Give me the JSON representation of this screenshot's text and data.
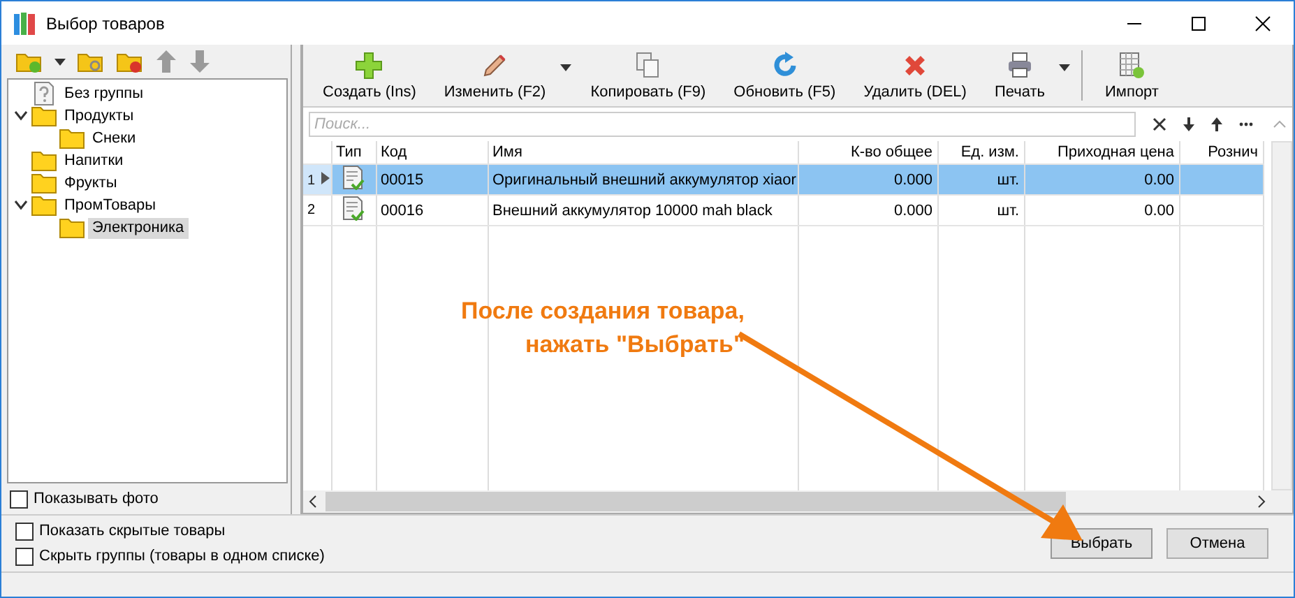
{
  "window": {
    "title": "Выбор товаров"
  },
  "tree": [
    {
      "label": "Без группы",
      "kind": "nogroup",
      "selected": false,
      "expanded": false
    },
    {
      "label": "Продукты",
      "kind": "folder",
      "selected": false,
      "expanded": true,
      "children": [
        {
          "label": "Снеки",
          "kind": "folder",
          "selected": false,
          "expanded": false
        }
      ]
    },
    {
      "label": "Напитки",
      "kind": "folder",
      "selected": false,
      "expanded": false
    },
    {
      "label": "Фрукты",
      "kind": "folder",
      "selected": false,
      "expanded": false
    },
    {
      "label": "ПромТовары",
      "kind": "folder",
      "selected": false,
      "expanded": true,
      "children": [
        {
          "label": "Электроника",
          "kind": "folder",
          "selected": true,
          "expanded": false
        }
      ]
    }
  ],
  "show_photo": {
    "label": "Показывать фото",
    "checked": false
  },
  "toolbar": [
    {
      "label": "Создать (Ins)",
      "kind": "create",
      "dropdown": false
    },
    {
      "label": "Изменить (F2)",
      "kind": "edit",
      "dropdown": true
    },
    {
      "label": "Копировать (F9)",
      "kind": "copy",
      "dropdown": false
    },
    {
      "label": "Обновить (F5)",
      "kind": "refresh",
      "dropdown": false
    },
    {
      "label": "Удалить (DEL)",
      "kind": "delete",
      "dropdown": false
    },
    {
      "label": "Печать",
      "kind": "print",
      "dropdown": true
    },
    {
      "label": "Импорт",
      "kind": "import",
      "dropdown": false
    }
  ],
  "search": {
    "placeholder": "Поиск..."
  },
  "table": {
    "columns": [
      "Тип",
      "Код",
      "Имя",
      "К-во общее",
      "Ед. изм.",
      "Приходная цена",
      "Рознич"
    ],
    "rows": [
      {
        "number": "1",
        "selected": true,
        "cells": [
          "",
          "00015",
          "Оригинальный внешний аккумулятор xiaor",
          "0.000",
          "шт.",
          "0.00"
        ]
      },
      {
        "number": "2",
        "selected": false,
        "cells": [
          "",
          "00016",
          "Внешний аккумулятор 10000 mah black",
          "0.000",
          "шт.",
          "0.00"
        ]
      }
    ]
  },
  "options": [
    {
      "label": "Показать скрытые товары",
      "checked": false
    },
    {
      "label": "Скрыть группы (товары в одном списке)",
      "checked": false
    }
  ],
  "buttons": [
    {
      "label": "Выбрать",
      "kind": "primary"
    },
    {
      "label": "Отмена",
      "kind": "cancel"
    }
  ],
  "annotation": {
    "lines": [
      "После создания товара,",
      "нажать \"Выбрать\""
    ]
  }
}
